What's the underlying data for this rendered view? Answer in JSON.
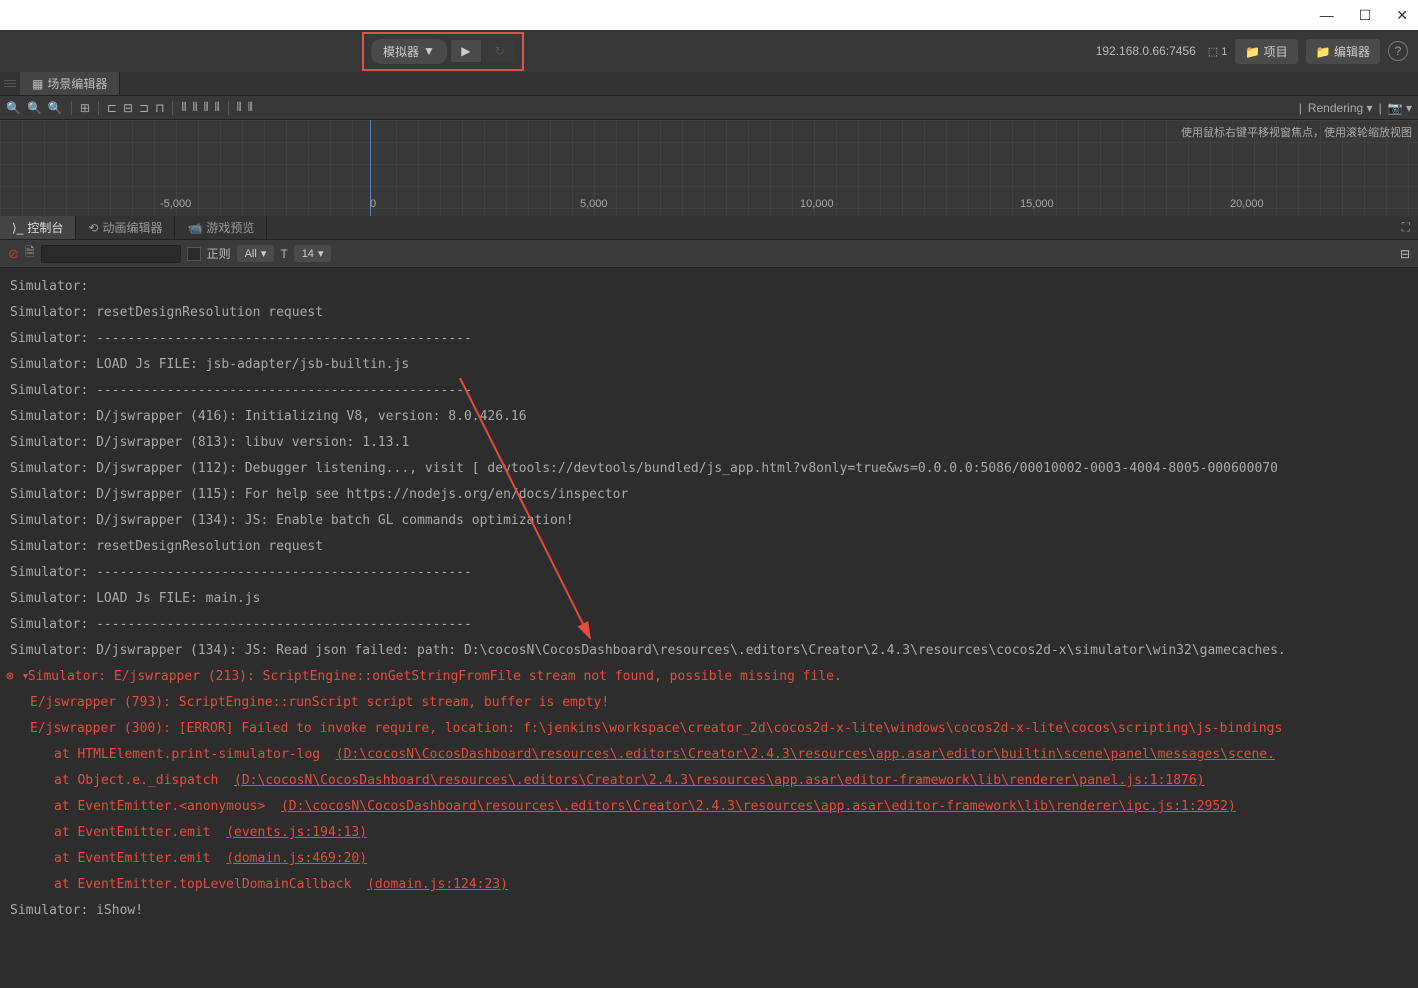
{
  "window": {
    "min": "—",
    "max": "☐",
    "close": "✕"
  },
  "toolbar": {
    "sim_label": "模拟器",
    "ip": "192.168.0.66:7456",
    "wifi_count": "1",
    "project_btn": "项目",
    "editor_btn": "编辑器"
  },
  "tabs": {
    "scene_editor": "场景编辑器"
  },
  "scene": {
    "rendering": "Rendering",
    "hint": "使用鼠标右键平移视窗焦点，使用滚轮缩放视图",
    "ruler": [
      "-5,000",
      "0",
      "5,000",
      "10,000",
      "15,000",
      "20,000"
    ]
  },
  "console_tabs": {
    "console": "控制台",
    "anim": "动画编辑器",
    "preview": "游戏预览"
  },
  "filter": {
    "regex": "正则",
    "level": "All",
    "fontsize": "14"
  },
  "logs": [
    "Simulator:",
    "Simulator: resetDesignResolution request",
    "Simulator: ------------------------------------------------",
    "Simulator: LOAD Js FILE: jsb-adapter/jsb-builtin.js",
    "Simulator: ------------------------------------------------",
    "Simulator: D/jswrapper (416): Initializing V8, version: 8.0.426.16",
    "Simulator: D/jswrapper (813): libuv version: 1.13.1",
    "Simulator: D/jswrapper (112): Debugger listening..., visit [ devtools://devtools/bundled/js_app.html?v8only=true&ws=0.0.0.0:5086/00010002-0003-4004-8005-000600070",
    "Simulator: D/jswrapper (115): For help see https://nodejs.org/en/docs/inspector",
    "Simulator: D/jswrapper (134): JS: Enable batch GL commands optimization!",
    "Simulator: resetDesignResolution request",
    "Simulator: ------------------------------------------------",
    "Simulator: LOAD Js FILE: main.js",
    "Simulator: ------------------------------------------------",
    "Simulator: D/jswrapper (134): JS: Read json failed: path: D:\\cocosN\\CocosDashboard\\resources\\.editors\\Creator\\2.4.3\\resources\\cocos2d-x\\simulator\\win32\\gamecaches."
  ],
  "errors": {
    "main": "Simulator: E/jswrapper (213): ScriptEngine::onGetStringFromFile stream not found, possible missing file.",
    "sub1": "E/jswrapper (793): ScriptEngine::runScript script stream, buffer is empty!",
    "sub2": "E/jswrapper (300): [ERROR] Failed to invoke require, location: f:\\jenkins\\workspace\\creator_2d\\cocos2d-x-lite\\windows\\cocos2d-x-lite\\cocos\\scripting\\js-bindings",
    "stack": [
      {
        "text": "at HTMLElement.print-simulator-log",
        "link": "(D:\\cocosN\\CocosDashboard\\resources\\.editors\\Creator\\2.4.3\\resources\\app.asar\\editor\\builtin\\scene\\panel\\messages\\scene."
      },
      {
        "text": "at Object.e._dispatch",
        "link": "(D:\\cocosN\\CocosDashboard\\resources\\.editors\\Creator\\2.4.3\\resources\\app.asar\\editor-framework\\lib\\renderer\\panel.js:1:1876)"
      },
      {
        "text": "at EventEmitter.<anonymous>",
        "link": "(D:\\cocosN\\CocosDashboard\\resources\\.editors\\Creator\\2.4.3\\resources\\app.asar\\editor-framework\\lib\\renderer\\ipc.js:1:2952)"
      },
      {
        "text": "at EventEmitter.emit",
        "link": "(events.js:194:13)"
      },
      {
        "text": "at EventEmitter.emit",
        "link": "(domain.js:469:20)"
      },
      {
        "text": "at EventEmitter.topLevelDomainCallback",
        "link": "(domain.js:124:23)"
      }
    ]
  },
  "logs_after": "Simulator: iShow!"
}
